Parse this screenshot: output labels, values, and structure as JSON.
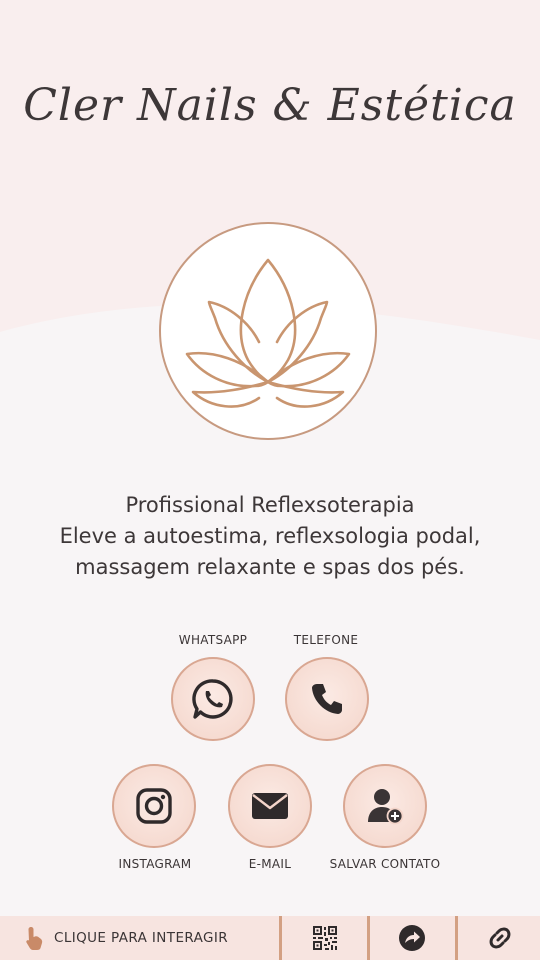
{
  "brand": {
    "title": "Cler Nails & Estética"
  },
  "description": {
    "line1": "Profissional Reflexsoterapia",
    "line2": "Eleve a autoestima, reflexsologia podal,",
    "line3": "massagem relaxante e spas dos pés."
  },
  "buttons": {
    "whatsapp": {
      "label": "WHATSAPP",
      "icon": "whatsapp-icon"
    },
    "telefone": {
      "label": "TELEFONE",
      "icon": "phone-icon"
    },
    "instagram": {
      "label": "INSTAGRAM",
      "icon": "instagram-icon"
    },
    "email": {
      "label": "E-MAIL",
      "icon": "envelope-icon"
    },
    "salvar": {
      "label": "SALVAR CONTATO",
      "icon": "add-contact-icon"
    }
  },
  "bottom_bar": {
    "interact_label": "CLIQUE  PARA INTERAGIR",
    "icons": [
      "tap-hand-icon",
      "qr-code-icon",
      "share-arrow-icon",
      "link-icon"
    ]
  },
  "colors": {
    "accent": "#c79a80",
    "button_fill": "#f4d5ca",
    "button_border": "#d9a792",
    "background_top": "#f9eeee",
    "background": "#f8f5f6",
    "bar": "#f7e4e0"
  }
}
